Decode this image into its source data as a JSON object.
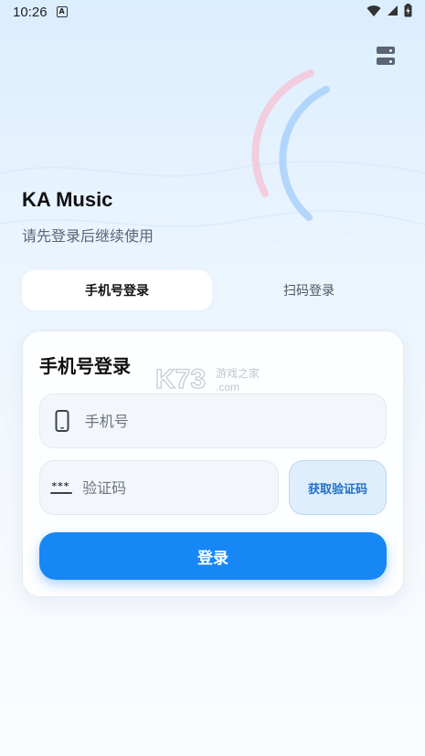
{
  "status_bar": {
    "time": "10:26",
    "a_icon": "A"
  },
  "app": {
    "title": "KA Music",
    "subtitle": "请先登录后继续使用"
  },
  "tabs": [
    {
      "label": "手机号登录",
      "active": true
    },
    {
      "label": "扫码登录",
      "active": false
    }
  ],
  "form": {
    "title": "手机号登录",
    "phone_placeholder": "手机号",
    "code_placeholder": "验证码",
    "code_icon_text": "***",
    "get_code_label": "获取验证码",
    "login_label": "登录"
  },
  "watermark": {
    "logo": "K73",
    "text": "游戏之家",
    "domain": ".com"
  },
  "colors": {
    "primary": "#1787f5",
    "arc_pink": "#f3c7d8",
    "arc_blue": "#a9d0fb"
  }
}
